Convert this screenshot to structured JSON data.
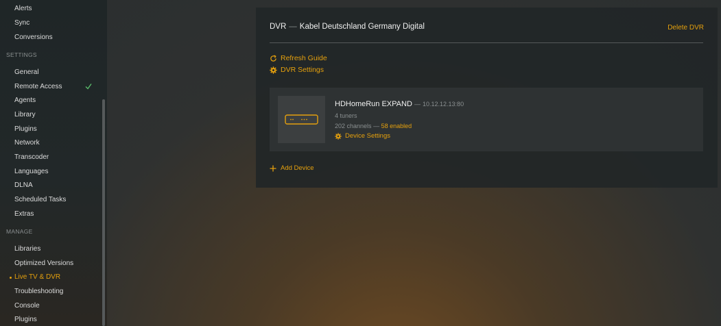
{
  "sidebar": {
    "top_items": [
      "Alerts",
      "Sync",
      "Conversions"
    ],
    "settings_heading": "SETTINGS",
    "settings_items": [
      "General",
      "Remote Access",
      "Agents",
      "Library",
      "Plugins",
      "Network",
      "Transcoder",
      "Languages",
      "DLNA",
      "Scheduled Tasks",
      "Extras"
    ],
    "manage_heading": "MANAGE",
    "manage_items": [
      "Libraries",
      "Optimized Versions",
      "Live TV & DVR",
      "Troubleshooting",
      "Console",
      "Plugins"
    ],
    "active_item": "Live TV & DVR",
    "checked_item": "Remote Access"
  },
  "dvr": {
    "label": "DVR",
    "separator": "—",
    "name": "Kabel Deutschland Germany Digital",
    "delete_label": "Delete DVR",
    "refresh_label": "Refresh Guide",
    "settings_label": "DVR Settings",
    "device": {
      "name": "HDHomeRun EXPAND",
      "ip_prefix": "—",
      "ip": "10.12.12.13:80",
      "tuners": "4 tuners",
      "channels": "202 channels",
      "channels_sep": "—",
      "enabled": "58 enabled",
      "settings_label": "Device Settings"
    },
    "add_device_label": "Add Device"
  },
  "colors": {
    "accent": "#e5a00d",
    "check": "#5cc26e",
    "text": "#e9e9e9",
    "muted": "#8a8f90"
  },
  "icons": {
    "refresh": "refresh-icon",
    "gear": "gear-icon",
    "plus": "plus-icon",
    "check": "check-icon",
    "device": "tuner-device-icon"
  }
}
